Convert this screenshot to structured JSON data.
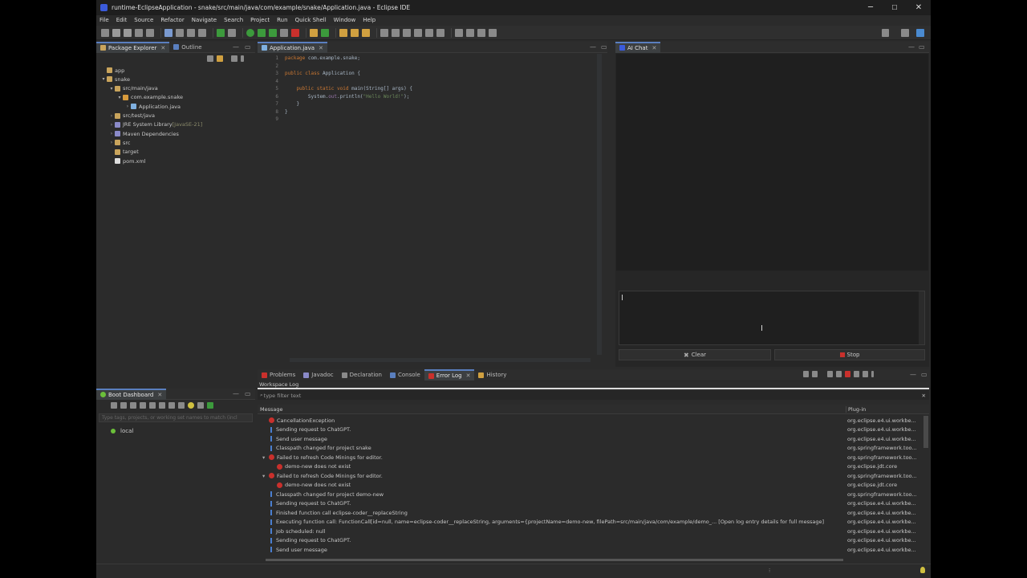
{
  "window": {
    "title": "runtime-EclipseApplication - snake/src/main/java/com/example/snake/Application.java - Eclipse IDE",
    "minimize": "─",
    "maximize": "☐",
    "close": "✕"
  },
  "menu": [
    "File",
    "Edit",
    "Source",
    "Refactor",
    "Navigate",
    "Search",
    "Project",
    "Run",
    "Quick Shell",
    "Window",
    "Help"
  ],
  "explorer": {
    "tabs": [
      {
        "label": "Package Explorer"
      },
      {
        "label": "Outline"
      }
    ],
    "tree": [
      {
        "label": "app",
        "twisty": "",
        "indent": 0,
        "icon": "#c9a45c",
        "active": false
      },
      {
        "label": "snake",
        "twisty": "▾",
        "indent": 0,
        "icon": "#c9a45c",
        "active": false
      },
      {
        "label": "src/main/java",
        "twisty": "▾",
        "indent": 1,
        "icon": "#c9a45c",
        "active": false
      },
      {
        "label": "com.example.snake",
        "twisty": "▾",
        "indent": 2,
        "icon": "#d79a3c",
        "active": false
      },
      {
        "label": "Application.java",
        "twisty": "›",
        "indent": 3,
        "icon": "#7fb0e0",
        "active": false
      },
      {
        "label": "src/test/java",
        "twisty": "›",
        "indent": 1,
        "icon": "#c9a45c",
        "active": false
      },
      {
        "label": "JRE System Library",
        "suffix": " [JavaSE-21]",
        "twisty": "›",
        "indent": 1,
        "icon": "#8a8ac8",
        "active": false
      },
      {
        "label": "Maven Dependencies",
        "twisty": "›",
        "indent": 1,
        "icon": "#8a8ac8",
        "active": false
      },
      {
        "label": "src",
        "twisty": "›",
        "indent": 1,
        "icon": "#c9a45c",
        "active": false
      },
      {
        "label": "target",
        "twisty": "",
        "indent": 1,
        "icon": "#c9a45c",
        "active": false
      },
      {
        "label": "pom.xml",
        "twisty": "",
        "indent": 1,
        "icon": "#dddddd",
        "active": false
      }
    ]
  },
  "editor": {
    "tab": "Application.java",
    "lines": [
      {
        "n": "1",
        "parts": [
          {
            "t": "package ",
            "c": "kw"
          },
          {
            "t": "com.example.snake;",
            "c": "tx"
          }
        ]
      },
      {
        "n": "2",
        "parts": []
      },
      {
        "n": "3",
        "parts": [
          {
            "t": "public class ",
            "c": "kw"
          },
          {
            "t": "Application {",
            "c": "tx"
          }
        ]
      },
      {
        "n": "4",
        "parts": []
      },
      {
        "n": "5",
        "parts": [
          {
            "t": "    public static void ",
            "c": "kw"
          },
          {
            "t": "main(",
            "c": "tx"
          },
          {
            "t": "String",
            "c": "tx"
          },
          {
            "t": "[] args) {",
            "c": "tx"
          }
        ]
      },
      {
        "n": "6",
        "parts": [
          {
            "t": "        System.",
            "c": "tx"
          },
          {
            "t": "out",
            "c": "fld"
          },
          {
            "t": ".println(",
            "c": "tx"
          },
          {
            "t": "\"Hello World!\"",
            "c": "str"
          },
          {
            "t": ");",
            "c": "tx"
          }
        ]
      },
      {
        "n": "7",
        "parts": [
          {
            "t": "    }",
            "c": "tx"
          }
        ]
      },
      {
        "n": "8",
        "parts": [
          {
            "t": "}",
            "c": "tx"
          }
        ]
      },
      {
        "n": "9",
        "parts": []
      }
    ]
  },
  "chat": {
    "tab": "AI Chat",
    "clear": "Clear",
    "stop": "Stop"
  },
  "bottom": {
    "tabs": [
      {
        "label": "Problems"
      },
      {
        "label": "Javadoc"
      },
      {
        "label": "Declaration"
      },
      {
        "label": "Console"
      },
      {
        "label": "Error Log"
      },
      {
        "label": "History"
      }
    ],
    "workspace_log": "Workspace Log",
    "filter_placeholder": "type filter text",
    "col_message": "Message",
    "col_plugin": "Plug-in",
    "rows": [
      {
        "type": "error",
        "indent": 0,
        "twisty": "",
        "msg": "CancellationException",
        "plugin": "org.eclipse.e4.ui.workbe..."
      },
      {
        "type": "info",
        "indent": 0,
        "twisty": "",
        "msg": "Sending request to ChatGPT.",
        "plugin": "org.eclipse.e4.ui.workbe..."
      },
      {
        "type": "info",
        "indent": 0,
        "twisty": "",
        "msg": "Send user message",
        "plugin": "org.eclipse.e4.ui.workbe..."
      },
      {
        "type": "info",
        "indent": 0,
        "twisty": "",
        "msg": "Classpath changed for project snake",
        "plugin": "org.springframework.too..."
      },
      {
        "type": "error",
        "indent": 0,
        "twisty": "▾",
        "msg": "Failed to refresh Code Minings for editor.",
        "plugin": "org.springframework.too..."
      },
      {
        "type": "error",
        "indent": 1,
        "twisty": "",
        "msg": "demo-new does not exist",
        "plugin": "org.eclipse.jdt.core"
      },
      {
        "type": "error",
        "indent": 0,
        "twisty": "▾",
        "msg": "Failed to refresh Code Minings for editor.",
        "plugin": "org.springframework.too..."
      },
      {
        "type": "error",
        "indent": 1,
        "twisty": "",
        "msg": "demo-new does not exist",
        "plugin": "org.eclipse.jdt.core"
      },
      {
        "type": "info",
        "indent": 0,
        "twisty": "",
        "msg": "Classpath changed for project demo-new",
        "plugin": "org.springframework.too..."
      },
      {
        "type": "info",
        "indent": 0,
        "twisty": "",
        "msg": "Sending request to ChatGPT.",
        "plugin": "org.eclipse.e4.ui.workbe..."
      },
      {
        "type": "info",
        "indent": 0,
        "twisty": "",
        "msg": "Finished function call eclipse-coder__replaceString",
        "plugin": "org.eclipse.e4.ui.workbe..."
      },
      {
        "type": "info",
        "indent": 0,
        "twisty": "",
        "msg": "Executing function call: FunctionCall[id=null, name=eclipse-coder__replaceString, arguments={projectName=demo-new, filePath=src/main/java/com/example/demo_... [Open log entry details for full message]",
        "plugin": "org.eclipse.e4.ui.workbe..."
      },
      {
        "type": "info",
        "indent": 0,
        "twisty": "",
        "msg": "Job scheduled: null",
        "plugin": "org.eclipse.e4.ui.workbe..."
      },
      {
        "type": "info",
        "indent": 0,
        "twisty": "",
        "msg": "Sending request to ChatGPT.",
        "plugin": "org.eclipse.e4.ui.workbe..."
      },
      {
        "type": "info",
        "indent": 0,
        "twisty": "",
        "msg": "Send user message",
        "plugin": "org.eclipse.e4.ui.workbe..."
      }
    ]
  },
  "boot": {
    "tab": "Boot Dashboard",
    "filter_placeholder": "Type tags, projects, or working set names to match (incl",
    "item": "local"
  },
  "colors": {
    "accent": "#5a7fbf",
    "error": "#c9302c",
    "run": "#3c9a3c",
    "boot": "#6bbf3a"
  }
}
